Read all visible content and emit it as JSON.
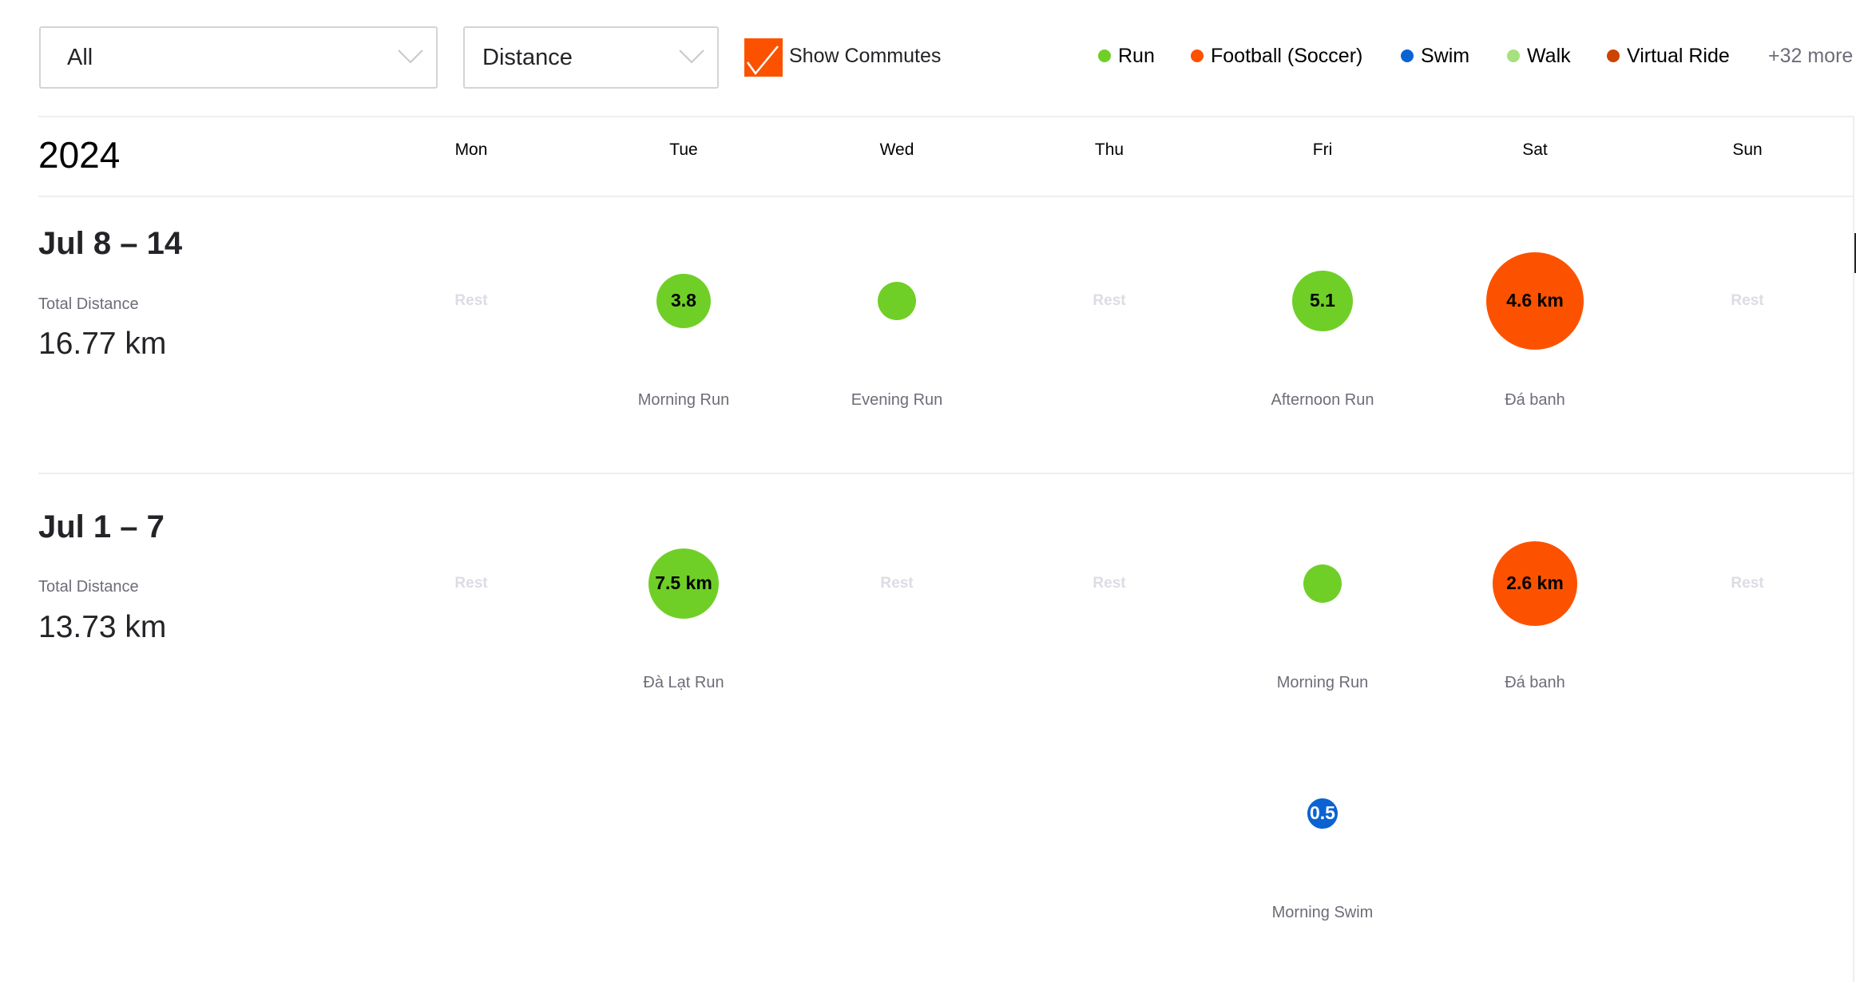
{
  "filters": {
    "sport_type": {
      "value": "All"
    },
    "metric": {
      "value": "Distance"
    },
    "show_commutes": {
      "label": "Show Commutes",
      "checked": true
    }
  },
  "legend": {
    "items": [
      {
        "label": "Run",
        "color": "#6fcf27"
      },
      {
        "label": "Football (Soccer)",
        "color": "#fc5200"
      },
      {
        "label": "Swim",
        "color": "#0b63d3"
      },
      {
        "label": "Walk",
        "color": "#a7e07e"
      },
      {
        "label": "Virtual Ride",
        "color": "#cc4400"
      }
    ],
    "more": "+32 more"
  },
  "calendar": {
    "year": "2024",
    "days": [
      "Mon",
      "Tue",
      "Wed",
      "Thu",
      "Fri",
      "Sat",
      "Sun"
    ],
    "rest_label": "Rest",
    "weeks": [
      {
        "title": "Jul 8 – 14",
        "total_label": "Total Distance",
        "total_value": "16.77 km",
        "rest_days": [
          "Mon",
          "Thu",
          "Sun"
        ],
        "activities": [
          {
            "day": "Tue",
            "name": "Morning Run",
            "sport": "Run",
            "label": "3.8",
            "distance_km": 3.8,
            "color": "#6fcf27",
            "text_color": "#000000"
          },
          {
            "day": "Wed",
            "name": "Evening Run",
            "sport": "Run",
            "label": "",
            "color": "#6fcf27",
            "text_color": "#000000"
          },
          {
            "day": "Fri",
            "name": "Afternoon Run",
            "sport": "Run",
            "label": "5.1",
            "distance_km": 5.1,
            "color": "#6fcf27",
            "text_color": "#000000"
          },
          {
            "day": "Sat",
            "name": "Đá banh",
            "sport": "Football (Soccer)",
            "label": "4.6 km",
            "distance_km": 4.6,
            "color": "#fc5200",
            "text_color": "#000000"
          }
        ]
      },
      {
        "title": "Jul 1 – 7",
        "total_label": "Total Distance",
        "total_value": "13.73 km",
        "rest_days": [
          "Mon",
          "Wed",
          "Thu",
          "Sun"
        ],
        "activities": [
          {
            "day": "Tue",
            "name": "Đà Lạt Run",
            "sport": "Run",
            "label": "7.5 km",
            "distance_km": 7.5,
            "color": "#6fcf27",
            "text_color": "#000000"
          },
          {
            "day": "Fri",
            "name": "Morning Run",
            "sport": "Run",
            "label": "",
            "color": "#6fcf27",
            "text_color": "#000000"
          },
          {
            "day": "Sat",
            "name": "Đá banh",
            "sport": "Football (Soccer)",
            "label": "2.6 km",
            "distance_km": 2.6,
            "color": "#fc5200",
            "text_color": "#000000"
          },
          {
            "day": "Fri",
            "name": "Morning Swim",
            "sport": "Swim",
            "label": "0.5",
            "distance_km": 0.5,
            "color": "#0b63d3",
            "text_color": "#ffffff"
          }
        ]
      }
    ]
  }
}
